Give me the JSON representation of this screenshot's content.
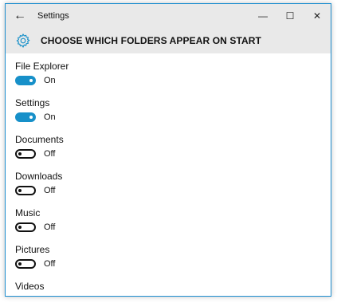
{
  "window": {
    "title": "Settings",
    "back_glyph": "←",
    "minimize_glyph": "—",
    "maximize_glyph": "☐",
    "close_glyph": "✕"
  },
  "header": {
    "icon": "gear-icon",
    "title": "CHOOSE WHICH FOLDERS APPEAR ON START"
  },
  "colors": {
    "accent": "#1790c9",
    "titlebar": "#e9e9e9",
    "border": "#1e8fd0"
  },
  "settings": [
    {
      "label": "File Explorer",
      "state": "On",
      "on": true
    },
    {
      "label": "Settings",
      "state": "On",
      "on": true
    },
    {
      "label": "Documents",
      "state": "Off",
      "on": false
    },
    {
      "label": "Downloads",
      "state": "Off",
      "on": false
    },
    {
      "label": "Music",
      "state": "Off",
      "on": false
    },
    {
      "label": "Pictures",
      "state": "Off",
      "on": false
    },
    {
      "label": "Videos"
    }
  ]
}
